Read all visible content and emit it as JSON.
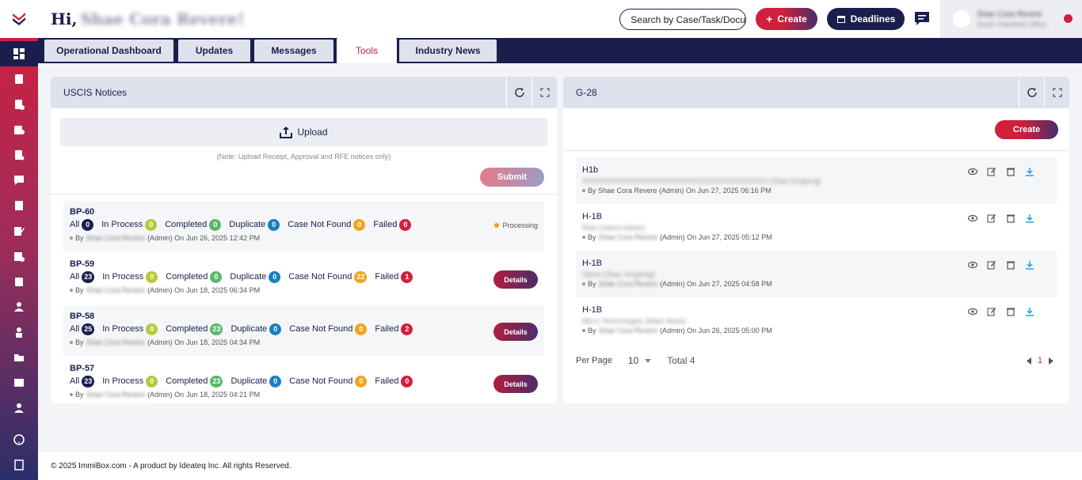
{
  "header": {
    "greeting": "Hi,",
    "user_name_blurred": "Shae Cora Revere!",
    "search_placeholder": "Search by Case/Task/Docu",
    "create_label": "Create",
    "deadlines_label": "Deadlines",
    "profile_name": "Shae Cora Revere",
    "profile_office": "South Plainfield Office"
  },
  "tabs": [
    {
      "label": "Operational Dashboard"
    },
    {
      "label": "Updates"
    },
    {
      "label": "Messages"
    },
    {
      "label": "Tools",
      "active": true
    },
    {
      "label": "Industry News"
    }
  ],
  "uscis": {
    "title": "USCIS Notices",
    "upload_label": "Upload",
    "note": "(Note: Upload Receipt, Approval and RFE notices only)",
    "submit_label": "Submit",
    "labels": {
      "all": "All",
      "in_process": "In Process",
      "completed": "Completed",
      "duplicate": "Duplicate",
      "case_not_found": "Case Not Found",
      "failed": "Failed",
      "processing": "Processing",
      "details": "Details",
      "by": "By",
      "admin": "(Admin) On"
    },
    "notices": [
      {
        "id": "BP-60",
        "all": "0",
        "in_process": "0",
        "completed": "0",
        "duplicate": "0",
        "case_not_found": "0",
        "failed": "0",
        "by_name": "Shae Cora Revere",
        "date": "Jun 26, 2025 12:42 PM",
        "status": "processing"
      },
      {
        "id": "BP-59",
        "all": "23",
        "in_process": "0",
        "completed": "0",
        "duplicate": "0",
        "case_not_found": "22",
        "failed": "1",
        "by_name": "Shae Cora Revere",
        "date": "Jun 18, 2025 06:34 PM",
        "status": "details"
      },
      {
        "id": "BP-58",
        "all": "25",
        "in_process": "0",
        "completed": "23",
        "duplicate": "0",
        "case_not_found": "0",
        "failed": "2",
        "by_name": "Shae Cora Revere",
        "date": "Jun 18, 2025 04:34 PM",
        "status": "details"
      },
      {
        "id": "BP-57",
        "all": "23",
        "in_process": "0",
        "completed": "23",
        "duplicate": "0",
        "case_not_found": "0",
        "failed": "0",
        "by_name": "Shae Cora Revere",
        "date": "Jun 18, 2025 04:21 PM",
        "status": "details"
      }
    ]
  },
  "g28": {
    "title": "G-28",
    "create_label": "Create",
    "rows": [
      {
        "title": "H1b",
        "sub": "XXXXXXXXXXXXXXXXXXXXXXXXXXXXXXXXXXXXXXX (Zhao Xingtong)",
        "by": "By Shae Cora Revere (Admin) On Jun 27, 2025 06:16 PM",
        "by_name_blurred": ""
      },
      {
        "title": "H-1B",
        "sub": "Ram (Vamsi Admin)",
        "by_prefix": "By",
        "by_name_blurred": "Shae Cora Revere",
        "by_suffix": "(Admin) On Jun 27, 2025 05:12 PM"
      },
      {
        "title": "H-1B",
        "sub": "Vamsi (Zhao Xingtong)",
        "by_prefix": "By",
        "by_name_blurred": "Shae Cora Revere",
        "by_suffix": "(Admin) On Jun 27, 2025 04:58 PM"
      },
      {
        "title": "H-1B",
        "sub": "Micro Technologies (Mark Stone)",
        "by_prefix": "By",
        "by_name_blurred": "Shae Cora Revere",
        "by_suffix": "(Admin) On Jun 26, 2025 05:00 PM"
      }
    ],
    "pager": {
      "per_page_label": "Per Page",
      "per_page": "10",
      "total_label": "Total 4",
      "page": "1"
    }
  },
  "footer": "© 2025 ImmiBox.com - A product by Ideateq Inc. All rights Reserved.",
  "colors": {
    "brand_red": "#d21f3c",
    "navy": "#1b1e4d"
  }
}
